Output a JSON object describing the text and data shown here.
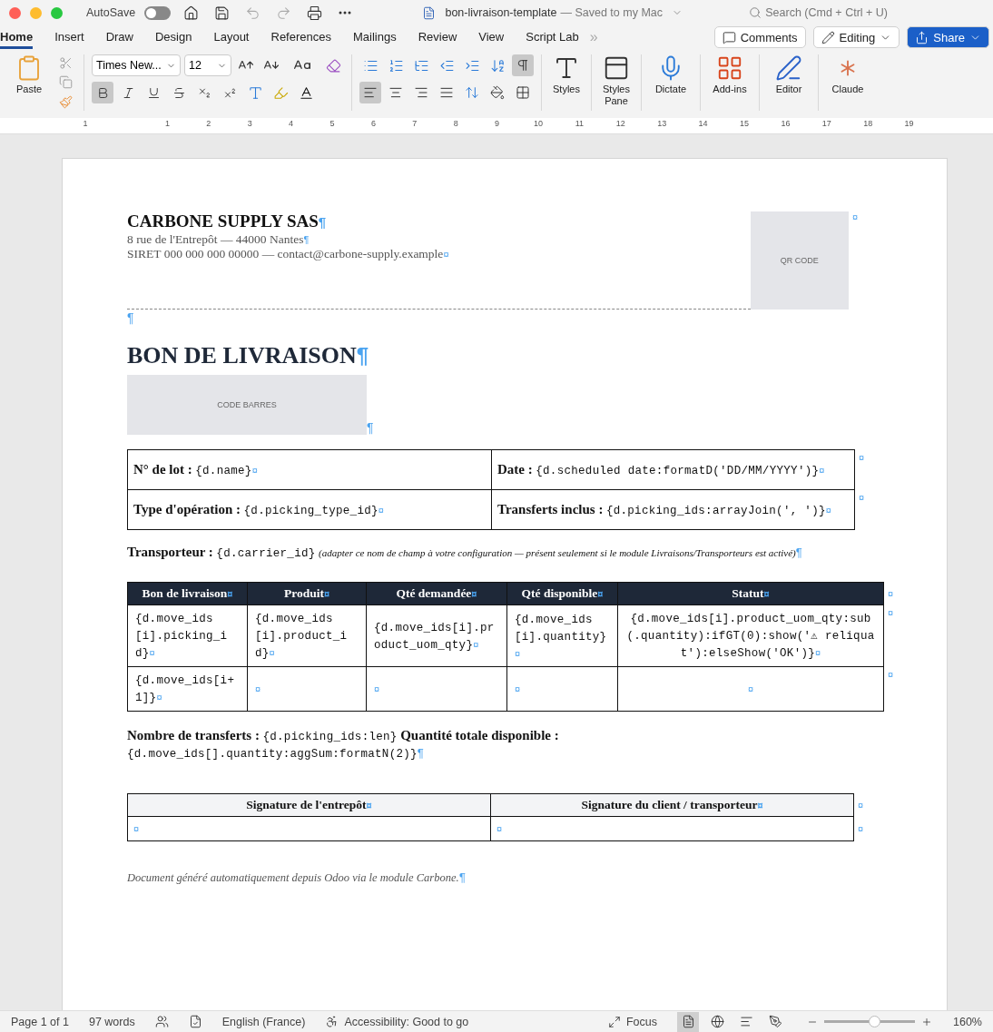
{
  "title_bar": {
    "autosave_label": "AutoSave",
    "autosave_on": false,
    "doc_name": "bon-livraison-template",
    "save_status": "— Saved to my Mac",
    "search_placeholder": "Search (Cmd + Ctrl + U)"
  },
  "ribbon_tabs": [
    {
      "label": "Home",
      "selected": true
    },
    {
      "label": "Insert",
      "selected": false
    },
    {
      "label": "Draw",
      "selected": false
    },
    {
      "label": "Design",
      "selected": false
    },
    {
      "label": "Layout",
      "selected": false
    },
    {
      "label": "References",
      "selected": false
    },
    {
      "label": "Mailings",
      "selected": false
    },
    {
      "label": "Review",
      "selected": false
    },
    {
      "label": "View",
      "selected": false
    },
    {
      "label": "Script Lab",
      "selected": false
    }
  ],
  "more_tabs": "»",
  "header_buttons": {
    "comments": "Comments",
    "editing": "Editing",
    "share": "Share"
  },
  "ribbon": {
    "paste": "Paste",
    "font": "Times New...",
    "size": "12",
    "bold_on": true,
    "italic_on": false,
    "underline_on": false,
    "align_left_on": true,
    "show_marks_on": true,
    "big_buttons": [
      {
        "kind": "styles",
        "label": "Styles"
      },
      {
        "kind": "pane",
        "label": "Styles Pane"
      },
      {
        "kind": "dictate",
        "label": "Dictate"
      },
      {
        "kind": "addins",
        "label": "Add-ins"
      },
      {
        "kind": "editor",
        "label": "Editor"
      },
      {
        "kind": "claude",
        "label": "Claude"
      }
    ]
  },
  "ruler": {
    "numbers": [
      "1",
      "1",
      "2",
      "3",
      "4",
      "5",
      "6",
      "7",
      "8",
      "9",
      "10",
      "11",
      "12",
      "13",
      "14",
      "15",
      "16",
      "17",
      "18",
      "19"
    ]
  },
  "marks": {
    "paragraph": "¶",
    "cell": "¤"
  },
  "document": {
    "company": {
      "name": "CARBONE SUPPLY SAS",
      "address": "8 rue de l'Entrepôt — 44000 Nantes",
      "contact": "SIRET 000 000 000 00000 — contact@carbone-supply.example"
    },
    "qr_placeholder": "QR CODE",
    "title": "BON DE LIVRAISON",
    "barcode_placeholder": "CODE BARRES",
    "info_rows": [
      [
        {
          "label": "N° de lot :",
          "value": "{d.name}"
        },
        {
          "label": "Date :",
          "value": "{d.scheduled date:formatD('DD/MM/YYYY')}"
        }
      ],
      [
        {
          "label": "Type d'opération :",
          "value": "{d.picking_type_id}"
        },
        {
          "label": "Transferts inclus :",
          "value": "{d.picking_ids:arrayJoin(', ')}"
        }
      ]
    ],
    "carrier": {
      "label": "Transporteur :",
      "value": "{d.carrier_id}",
      "note": "(adapter ce nom de champ à votre configuration — présent seulement si le module Livraisons/Transporteurs est activé)"
    },
    "lines_table": {
      "columns": [
        "Bon de livraison",
        "Produit",
        "Qté demandée",
        "Qté disponible",
        "Statut"
      ],
      "rows": [
        [
          "{d.move_ids[i].picking_id}",
          "{d.move_ids[i].product_id}",
          "{d.move_ids[i].product_uom_qty}",
          "{d.move_ids[i].quantity}",
          "{d.move_ids[i].product_uom_qty:sub(.quantity):ifGT(0):show('⚠ reliquat'):elseShow('OK')}"
        ],
        [
          "{d.move_ids[i+1]}"
        ]
      ]
    },
    "totals": {
      "count_label": "Nombre de transferts :",
      "count_value": "{d.picking_ids:len}",
      "qty_label": "Quantité totale disponible :",
      "qty_value": "{d.move_ids[].quantity:aggSum:formatN(2)}"
    },
    "signatures": [
      "Signature de l'entrepôt",
      "Signature du client / transporteur"
    ],
    "footer_note": "Document généré automatiquement depuis Odoo via le module Carbone."
  },
  "status_bar": {
    "page": "Page 1 of 1",
    "words": "97 words",
    "language": "English (France)",
    "accessibility": "Accessibility: Good to go",
    "focus": "Focus",
    "zoom_slider": {
      "level": 0.55
    },
    "zoom": "160%"
  }
}
